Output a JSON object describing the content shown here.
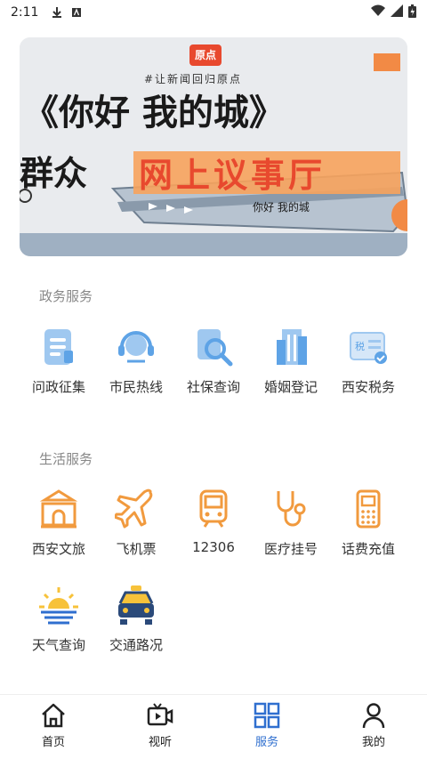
{
  "status_bar": {
    "time": "2:11"
  },
  "banner": {
    "logo_text": "原点",
    "tagline": "#让新闻回归原点",
    "title": "《你好 我的城》",
    "left_text": "群众",
    "highlight": "网上议事厅",
    "ship_text": "你好 我的城"
  },
  "gov_section": {
    "title": "政务服务",
    "items": [
      {
        "label": "问政征集"
      },
      {
        "label": "市民热线"
      },
      {
        "label": "社保查询"
      },
      {
        "label": "婚姻登记"
      },
      {
        "label": "西安税务"
      }
    ]
  },
  "life_section": {
    "title": "生活服务",
    "items": [
      {
        "label": "西安文旅"
      },
      {
        "label": "飞机票"
      },
      {
        "label": "12306"
      },
      {
        "label": "医疗挂号"
      },
      {
        "label": "话费充值"
      },
      {
        "label": "天气查询"
      },
      {
        "label": "交通路况"
      }
    ]
  },
  "tabbar": {
    "tabs": [
      {
        "label": "首页"
      },
      {
        "label": "视听"
      },
      {
        "label": "服务"
      },
      {
        "label": "我的"
      }
    ],
    "active_color": "#2f6fcf"
  },
  "colors": {
    "blue_icon": "#5ea3e6",
    "orange_icon": "#f19a3e",
    "accent": "#e8492e"
  }
}
